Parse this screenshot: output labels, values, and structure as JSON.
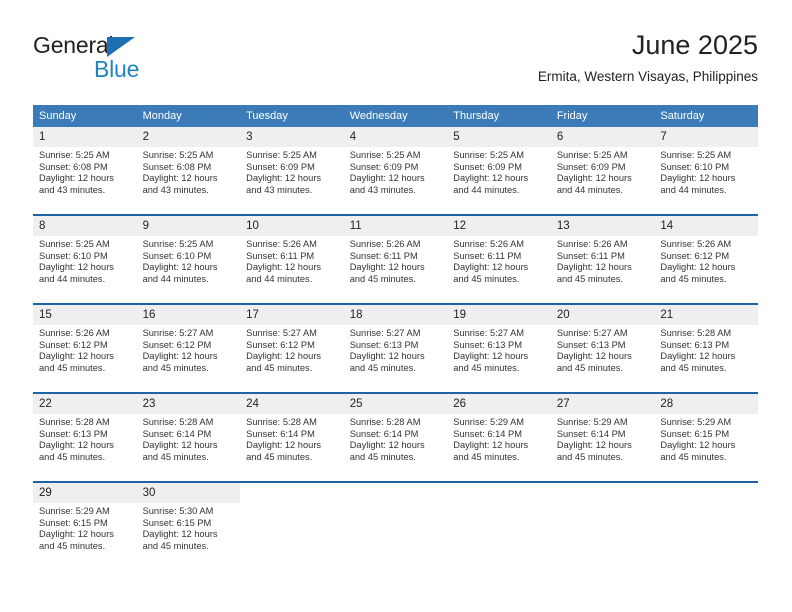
{
  "brand": {
    "name_top": "General",
    "name_bottom": "Blue",
    "triangle_color": "#1f6fb5",
    "blue_text_color": "#2183c4"
  },
  "header": {
    "title": "June 2025",
    "subtitle": "Ermita, Western Visayas, Philippines"
  },
  "theme": {
    "header_bg": "#3b7cb8",
    "header_text": "#ffffff",
    "date_band_bg": "#efefef",
    "row_divider": "#1f62a8",
    "body_text": "#333333"
  },
  "calendar": {
    "day_headers": [
      "Sunday",
      "Monday",
      "Tuesday",
      "Wednesday",
      "Thursday",
      "Friday",
      "Saturday"
    ],
    "weeks": [
      [
        {
          "day": "1",
          "text": "Sunrise: 5:25 AM\nSunset: 6:08 PM\nDaylight: 12 hours and 43 minutes."
        },
        {
          "day": "2",
          "text": "Sunrise: 5:25 AM\nSunset: 6:08 PM\nDaylight: 12 hours and 43 minutes."
        },
        {
          "day": "3",
          "text": "Sunrise: 5:25 AM\nSunset: 6:09 PM\nDaylight: 12 hours and 43 minutes."
        },
        {
          "day": "4",
          "text": "Sunrise: 5:25 AM\nSunset: 6:09 PM\nDaylight: 12 hours and 43 minutes."
        },
        {
          "day": "5",
          "text": "Sunrise: 5:25 AM\nSunset: 6:09 PM\nDaylight: 12 hours and 44 minutes."
        },
        {
          "day": "6",
          "text": "Sunrise: 5:25 AM\nSunset: 6:09 PM\nDaylight: 12 hours and 44 minutes."
        },
        {
          "day": "7",
          "text": "Sunrise: 5:25 AM\nSunset: 6:10 PM\nDaylight: 12 hours and 44 minutes."
        }
      ],
      [
        {
          "day": "8",
          "text": "Sunrise: 5:25 AM\nSunset: 6:10 PM\nDaylight: 12 hours and 44 minutes."
        },
        {
          "day": "9",
          "text": "Sunrise: 5:25 AM\nSunset: 6:10 PM\nDaylight: 12 hours and 44 minutes."
        },
        {
          "day": "10",
          "text": "Sunrise: 5:26 AM\nSunset: 6:11 PM\nDaylight: 12 hours and 44 minutes."
        },
        {
          "day": "11",
          "text": "Sunrise: 5:26 AM\nSunset: 6:11 PM\nDaylight: 12 hours and 45 minutes."
        },
        {
          "day": "12",
          "text": "Sunrise: 5:26 AM\nSunset: 6:11 PM\nDaylight: 12 hours and 45 minutes."
        },
        {
          "day": "13",
          "text": "Sunrise: 5:26 AM\nSunset: 6:11 PM\nDaylight: 12 hours and 45 minutes."
        },
        {
          "day": "14",
          "text": "Sunrise: 5:26 AM\nSunset: 6:12 PM\nDaylight: 12 hours and 45 minutes."
        }
      ],
      [
        {
          "day": "15",
          "text": "Sunrise: 5:26 AM\nSunset: 6:12 PM\nDaylight: 12 hours and 45 minutes."
        },
        {
          "day": "16",
          "text": "Sunrise: 5:27 AM\nSunset: 6:12 PM\nDaylight: 12 hours and 45 minutes."
        },
        {
          "day": "17",
          "text": "Sunrise: 5:27 AM\nSunset: 6:12 PM\nDaylight: 12 hours and 45 minutes."
        },
        {
          "day": "18",
          "text": "Sunrise: 5:27 AM\nSunset: 6:13 PM\nDaylight: 12 hours and 45 minutes."
        },
        {
          "day": "19",
          "text": "Sunrise: 5:27 AM\nSunset: 6:13 PM\nDaylight: 12 hours and 45 minutes."
        },
        {
          "day": "20",
          "text": "Sunrise: 5:27 AM\nSunset: 6:13 PM\nDaylight: 12 hours and 45 minutes."
        },
        {
          "day": "21",
          "text": "Sunrise: 5:28 AM\nSunset: 6:13 PM\nDaylight: 12 hours and 45 minutes."
        }
      ],
      [
        {
          "day": "22",
          "text": "Sunrise: 5:28 AM\nSunset: 6:13 PM\nDaylight: 12 hours and 45 minutes."
        },
        {
          "day": "23",
          "text": "Sunrise: 5:28 AM\nSunset: 6:14 PM\nDaylight: 12 hours and 45 minutes."
        },
        {
          "day": "24",
          "text": "Sunrise: 5:28 AM\nSunset: 6:14 PM\nDaylight: 12 hours and 45 minutes."
        },
        {
          "day": "25",
          "text": "Sunrise: 5:28 AM\nSunset: 6:14 PM\nDaylight: 12 hours and 45 minutes."
        },
        {
          "day": "26",
          "text": "Sunrise: 5:29 AM\nSunset: 6:14 PM\nDaylight: 12 hours and 45 minutes."
        },
        {
          "day": "27",
          "text": "Sunrise: 5:29 AM\nSunset: 6:14 PM\nDaylight: 12 hours and 45 minutes."
        },
        {
          "day": "28",
          "text": "Sunrise: 5:29 AM\nSunset: 6:15 PM\nDaylight: 12 hours and 45 minutes."
        }
      ],
      [
        {
          "day": "29",
          "text": "Sunrise: 5:29 AM\nSunset: 6:15 PM\nDaylight: 12 hours and 45 minutes."
        },
        {
          "day": "30",
          "text": "Sunrise: 5:30 AM\nSunset: 6:15 PM\nDaylight: 12 hours and 45 minutes."
        },
        {
          "day": "",
          "text": ""
        },
        {
          "day": "",
          "text": ""
        },
        {
          "day": "",
          "text": ""
        },
        {
          "day": "",
          "text": ""
        },
        {
          "day": "",
          "text": ""
        }
      ]
    ]
  }
}
